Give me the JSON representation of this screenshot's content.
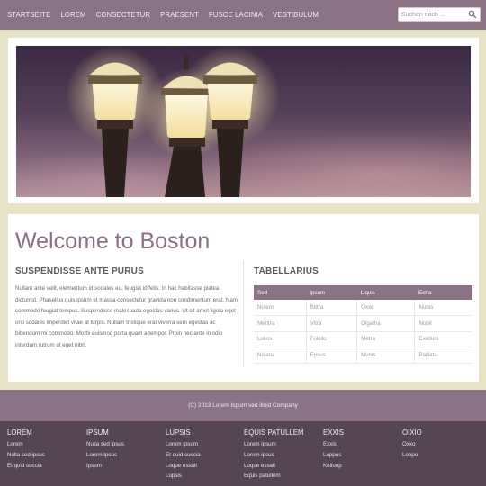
{
  "nav": {
    "items": [
      "STARTSEITE",
      "LOREM",
      "CONSECTETUR",
      "PRAESENT",
      "FUSCE LACINIA",
      "VESTIBULUM"
    ],
    "search_placeholder": "Suchen nach ..."
  },
  "hero": {
    "image_icon": "street-lamps-photo"
  },
  "main": {
    "title": "Welcome to Boston",
    "left": {
      "heading": "SUSPENDISSE ANTE PURUS",
      "text": "Nullam ante velit, elementum id sodales eu, feugiat id felis. In hac habitasse platea dictumst. Phasellus quis ipsum et massa consectetur gravida non condimentum erat. Nam commodo feugiat tempus. Suspendisse malesuada egestas varius. Ut sit amet ligula eget orci sodales imperdiet vitae at turpis. Nullam tristique erat viverra sem egestas ac bibendum mi commodo. Morbi euismod porta quam a tempor. Proin nec ante in odio interdum rutrum ut eget nibh."
    },
    "right": {
      "heading": "TABELLARIUS",
      "table": {
        "headers": [
          "Sed",
          "Ipsum",
          "Liquis",
          "Extra"
        ],
        "rows": [
          [
            "Nolem",
            "Bittra",
            "Oxxe",
            "Nubis"
          ],
          [
            "Mentra",
            "Vitra",
            "Olgatha",
            "Nobil"
          ],
          [
            "Lukos",
            "Fokillo",
            "Metra",
            "Exellum"
          ],
          [
            "Nolata",
            "Epsus",
            "Munis",
            "Palliata"
          ]
        ]
      }
    }
  },
  "copyright": "(C) 2013 Lorem Ispum sed illoid Company",
  "footer": {
    "columns": [
      {
        "heading": "LOREM",
        "links": [
          "Lorem",
          "Nulla sed ipsus",
          "Et quid succia"
        ]
      },
      {
        "heading": "IPSUM",
        "links": [
          "Nulla sed ipsus",
          "Lorem Ipsus",
          "Ipsum"
        ]
      },
      {
        "heading": "LUPSIS",
        "links": [
          "Lorem Ipsum",
          "Et quid succia",
          "Loque essalt",
          "Lupsis"
        ]
      },
      {
        "heading": "EQUIS PATULLEM",
        "links": [
          "Lorem ipsum",
          "Lorem ipsus",
          "Loque essalt",
          "Equis patullem"
        ]
      },
      {
        "heading": "EXXIS",
        "links": [
          "Exxis",
          "Luppus",
          "Kulluop"
        ]
      },
      {
        "heading": "OIXIO",
        "links": [
          "Oxxo",
          "Loppo"
        ]
      }
    ]
  },
  "colors": {
    "accent": "#8c7286",
    "page_bg": "#e6e3c6",
    "footer_bg": "#564653",
    "title": "#8a6f85"
  }
}
